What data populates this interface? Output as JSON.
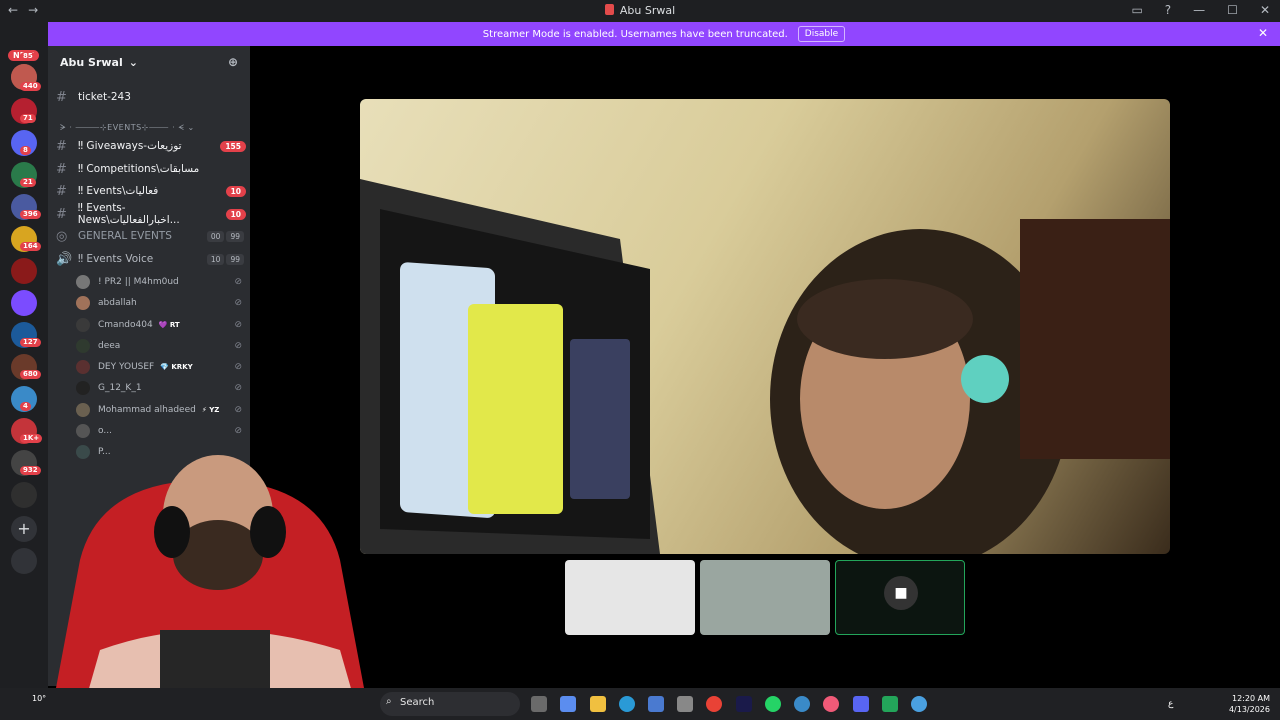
{
  "window": {
    "title": "Abu Srwal",
    "nav_back": "←",
    "nav_fwd": "→",
    "inbox_icon": "▭",
    "help_icon": "?",
    "min": "—",
    "max": "☐",
    "close": "✕"
  },
  "banner": {
    "text": "Streamer Mode is enabled. Usernames have been truncated.",
    "button": "Disable",
    "close": "✕"
  },
  "guild_badges": [
    "85",
    "440",
    "71",
    "8",
    "21",
    "396",
    "164",
    "127",
    "680",
    "4",
    "1K+",
    "932"
  ],
  "guild_new": "NEW",
  "server": {
    "name": "Abu Srwal",
    "chevron": "⌄"
  },
  "channels": {
    "ticket": "ticket-243",
    "events_category": "ᗒ · ⸻⊹EVENTS⊹⸻ · ᗕ ⌄",
    "giveaways": "‼ Giveaways-توزيعات",
    "giveaways_badge": "155",
    "competitions": "‼ Competitions\\مسابقات",
    "events": "‼ Events\\فعاليات",
    "events_badge": "10",
    "events_news": "‼ Events-News\\اخبارالفعاليات...",
    "events_news_badge": "10",
    "general_events": "GENERAL EVENTS",
    "general_events_a": "00",
    "general_events_b": "99",
    "events_voice": "‼ Events Voice",
    "events_voice_a": "10",
    "events_voice_b": "99"
  },
  "voice_users": [
    {
      "name": "! PR2 || M4hm0ud",
      "tag": ""
    },
    {
      "name": "abdallah",
      "tag": ""
    },
    {
      "name": "Cmando404",
      "tag": "💜 RT"
    },
    {
      "name": "deea",
      "tag": ""
    },
    {
      "name": "DEY YOUSEF",
      "tag": "💎 KRKY"
    },
    {
      "name": "G_12_K_1",
      "tag": ""
    },
    {
      "name": "Mohammad alhadeed",
      "tag": "⚡ YZ"
    },
    {
      "name": "o...",
      "tag": ""
    },
    {
      "name": "P...",
      "tag": ""
    }
  ],
  "taskbar": {
    "search": "Search",
    "time": "12:20 AM",
    "date": "4/13/2026",
    "weather": "10°",
    "lang": "ع"
  },
  "colors": {
    "banner": "#9146ff",
    "badge": "#e3414a",
    "sidebar": "#2b2d31",
    "rail": "#1e1f22",
    "voice_active": "#23a55a"
  }
}
